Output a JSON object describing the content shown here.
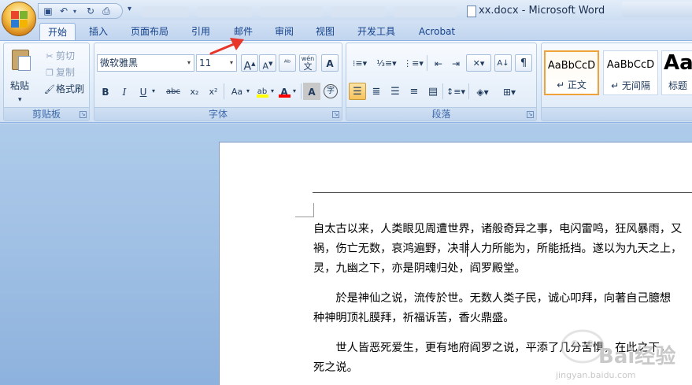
{
  "window": {
    "title": "xx.docx - Microsoft Word"
  },
  "tabs": [
    {
      "label": "开始",
      "active": true
    },
    {
      "label": "插入"
    },
    {
      "label": "页面布局"
    },
    {
      "label": "引用"
    },
    {
      "label": "邮件"
    },
    {
      "label": "审阅"
    },
    {
      "label": "视图"
    },
    {
      "label": "开发工具"
    },
    {
      "label": "Acrobat"
    }
  ],
  "clipboard": {
    "paste_label": "粘贴",
    "cut_label": "剪切",
    "copy_label": "复制",
    "format_painter_label": "格式刷",
    "group_label": "剪贴板"
  },
  "font": {
    "font_name": "微软雅黑",
    "font_size": "11",
    "group_label": "字体",
    "wen_label": "wén",
    "wen_char": "文",
    "wubi_label": "A",
    "bold": "B",
    "italic": "I",
    "underline": "U",
    "strike": "abc",
    "subscript": "x₂",
    "superscript": "x²",
    "change_case": "Aa",
    "highlight": "ab",
    "font_color": "A",
    "char_shading": "A",
    "enclose": "字",
    "highlight_color": "#ffff00",
    "font_color_bar": "#ff0000"
  },
  "paragraph": {
    "group_label": "段落"
  },
  "styles": [
    {
      "sample": "AaBbCcD",
      "name": "↵ 正文",
      "selected": true
    },
    {
      "sample": "AaBbCcD",
      "name": "↵ 无间隔"
    },
    {
      "sample": "Aa",
      "name": "标题"
    }
  ],
  "document": {
    "paragraphs": [
      [
        "自太古以来，人类眼见周遭世界，诸般奇异之事，电闪雷鸣，狂风暴雨，又",
        "祸，伤亡无数，哀鸿遍野，决非人力所能为，所能抵挡。遂以为九天之上，",
        "灵，九幽之下，亦是阴魂归处，阎罗殿堂。"
      ],
      [
        "　　於是神仙之说，流传於世。无数人类子民，诚心叩拜，向著自己臆想",
        "种神明顶礼膜拜，祈福诉苦，香火鼎盛。"
      ],
      [
        "　　世人皆恶死爱生，更有地府阎罗之说，平添了几分苦惧，在此之下，",
        "死之说。"
      ]
    ]
  },
  "watermark": {
    "text": "Bai经验",
    "url": "jingyan.baidu.com"
  }
}
